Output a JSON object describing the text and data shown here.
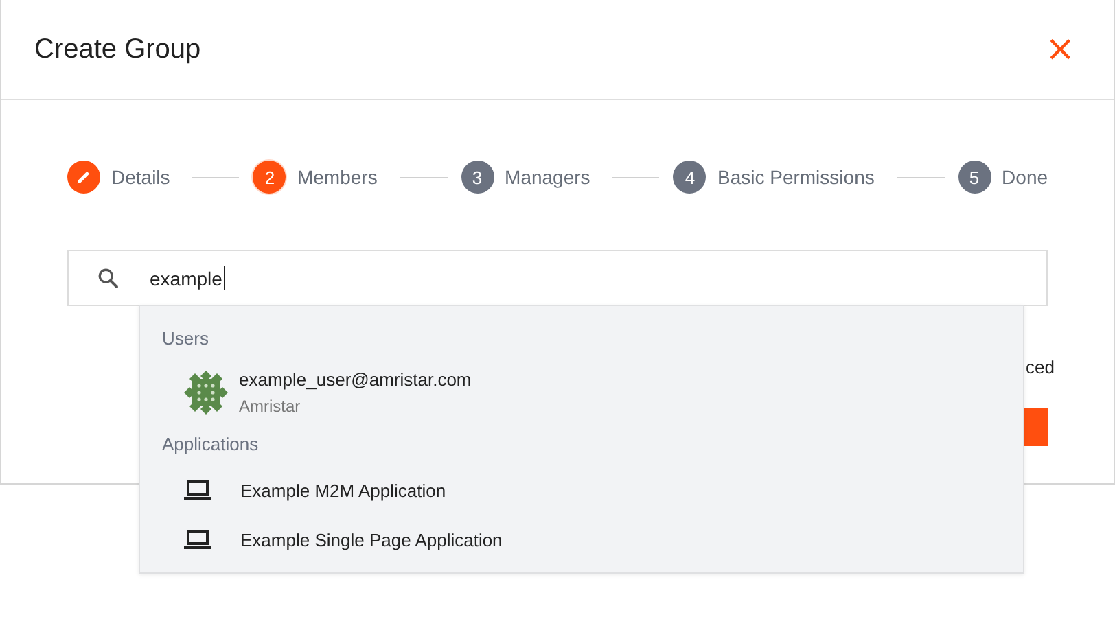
{
  "dialog": {
    "title": "Create Group",
    "close": "×"
  },
  "steps": [
    {
      "label": "Details",
      "completed": true,
      "selected": false
    },
    {
      "number": "2",
      "label": "Members",
      "completed": false,
      "selected": true
    },
    {
      "number": "3",
      "label": "Managers",
      "completed": false,
      "selected": false
    },
    {
      "number": "4",
      "label": "Basic Permissions",
      "completed": false,
      "selected": false
    },
    {
      "number": "5",
      "label": "Done",
      "completed": false,
      "selected": false
    }
  ],
  "search": {
    "value": "example"
  },
  "behind": {
    "text": "ced"
  },
  "results": [
    {
      "heading": "Users",
      "items": [
        {
          "kind": "user",
          "title": "example_user@amristar.com",
          "subtitle": "Amristar"
        }
      ]
    },
    {
      "heading": "Applications",
      "items": [
        {
          "kind": "application",
          "title": "Example M2M Application"
        },
        {
          "kind": "application",
          "title": "Example Single Page Application"
        }
      ]
    }
  ]
}
